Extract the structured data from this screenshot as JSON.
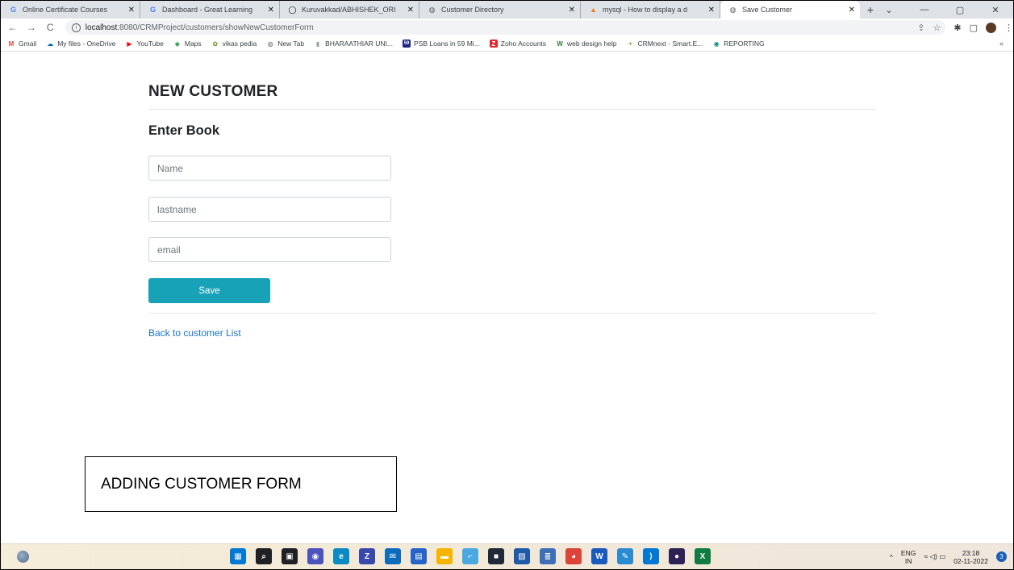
{
  "browser": {
    "tabs": [
      {
        "favicon": "G",
        "favicon_color": "#4285f4",
        "title": "Online Certificate Courses",
        "active": false
      },
      {
        "favicon": "G",
        "favicon_color": "#4285f4",
        "title": "Dashboard - Great Learning",
        "active": false
      },
      {
        "favicon": "◯",
        "favicon_color": "#000000",
        "title": "Kuruvakkad/ABHISHEK_ORI",
        "active": false
      },
      {
        "favicon": "◍",
        "favicon_color": "#5f6368",
        "title": "Customer Directory",
        "active": false
      },
      {
        "favicon": "▲",
        "favicon_color": "#f48024",
        "title": "mysql - How to display a d",
        "active": false
      },
      {
        "favicon": "◍",
        "favicon_color": "#5f6368",
        "title": "Save Customer",
        "active": true
      }
    ],
    "new_tab_symbol": "+",
    "window_controls": {
      "chevron": "⌄",
      "minimize": "—",
      "restore": "▢",
      "close": "✕"
    },
    "nav": {
      "back": "←",
      "forward": "→",
      "reload": "C"
    },
    "url_host": "localhost",
    "url_rest": ":8080/CRMProject/customers/showNewCustomerForm",
    "bookmarks": [
      {
        "icon": "M",
        "icon_color": "#ea4335",
        "label": "Gmail"
      },
      {
        "icon": "☁",
        "icon_color": "#0364b8",
        "label": "My files - OneDrive"
      },
      {
        "icon": "▶",
        "icon_color": "#ff0000",
        "label": "YouTube"
      },
      {
        "icon": "◆",
        "icon_color": "#34a853",
        "label": "Maps"
      },
      {
        "icon": "✿",
        "icon_color": "#6b8e23",
        "label": "vikas pedia"
      },
      {
        "icon": "◍",
        "icon_color": "#5f6368",
        "label": "New Tab"
      },
      {
        "icon": "▮",
        "icon_color": "#9aa0a6",
        "label": "BHARAATHIAR UNI..."
      },
      {
        "icon": "59",
        "icon_color": "#1a237e",
        "label": "PSB Loans in 59 Mi..."
      },
      {
        "icon": "Z",
        "icon_color": "#e42527",
        "label": "Zoho Accounts"
      },
      {
        "icon": "W",
        "icon_color": "#2e7d32",
        "label": "web design help"
      },
      {
        "icon": "✦",
        "icon_color": "#8bc34a",
        "label": "CRMnext - Smart.E..."
      },
      {
        "icon": "◉",
        "icon_color": "#00897b",
        "label": "REPORTING"
      }
    ],
    "bookmarks_more": "»"
  },
  "page": {
    "title": "NEW CUSTOMER",
    "form_heading": "Enter Book",
    "fields": {
      "name_placeholder": "Name",
      "lastname_placeholder": "lastname",
      "email_placeholder": "email"
    },
    "save_label": "Save",
    "back_link": "Back to customer List"
  },
  "caption": "ADDING CUSTOMER FORM",
  "taskbar": {
    "icons": [
      {
        "name": "start-icon",
        "glyph": "▦",
        "color": "#0078d4"
      },
      {
        "name": "search-icon",
        "glyph": "⌕",
        "color": "#202124"
      },
      {
        "name": "task-view-icon",
        "glyph": "▣",
        "color": "#202124"
      },
      {
        "name": "chat-icon",
        "glyph": "◉",
        "color": "#4b53bc"
      },
      {
        "name": "edge-icon",
        "glyph": "e",
        "color": "#0c8ac4"
      },
      {
        "name": "app-icon",
        "glyph": "Z",
        "color": "#3949ab"
      },
      {
        "name": "mail-icon",
        "glyph": "✉",
        "color": "#0f6cbd"
      },
      {
        "name": "store-icon",
        "glyph": "▤",
        "color": "#2563c9"
      },
      {
        "name": "folder-icon",
        "glyph": "▬",
        "color": "#f4b400"
      },
      {
        "name": "snip-icon",
        "glyph": "⌐",
        "color": "#4aa8e0"
      },
      {
        "name": "sticky-icon",
        "glyph": "■",
        "color": "#1f2937"
      },
      {
        "name": "remote-icon",
        "glyph": "▧",
        "color": "#1e5aa8"
      },
      {
        "name": "notepad-icon",
        "glyph": "≣",
        "color": "#3d6fb6"
      },
      {
        "name": "chrome-icon",
        "glyph": "◕",
        "color": "#db4437"
      },
      {
        "name": "word-icon",
        "glyph": "W",
        "color": "#185abd"
      },
      {
        "name": "paint-icon",
        "glyph": "✎",
        "color": "#2b8bd1"
      },
      {
        "name": "vscode-icon",
        "glyph": "⟩",
        "color": "#0078d4"
      },
      {
        "name": "eclipse-icon",
        "glyph": "●",
        "color": "#2c2255"
      },
      {
        "name": "excel-icon",
        "glyph": "X",
        "color": "#107c41"
      }
    ],
    "tray": {
      "chevron": "^",
      "lang_top": "ENG",
      "lang_bottom": "IN",
      "status_icons": "≈ ◁) ▭",
      "time": "23:18",
      "date": "02-11-2022",
      "notification_count": "3"
    }
  }
}
